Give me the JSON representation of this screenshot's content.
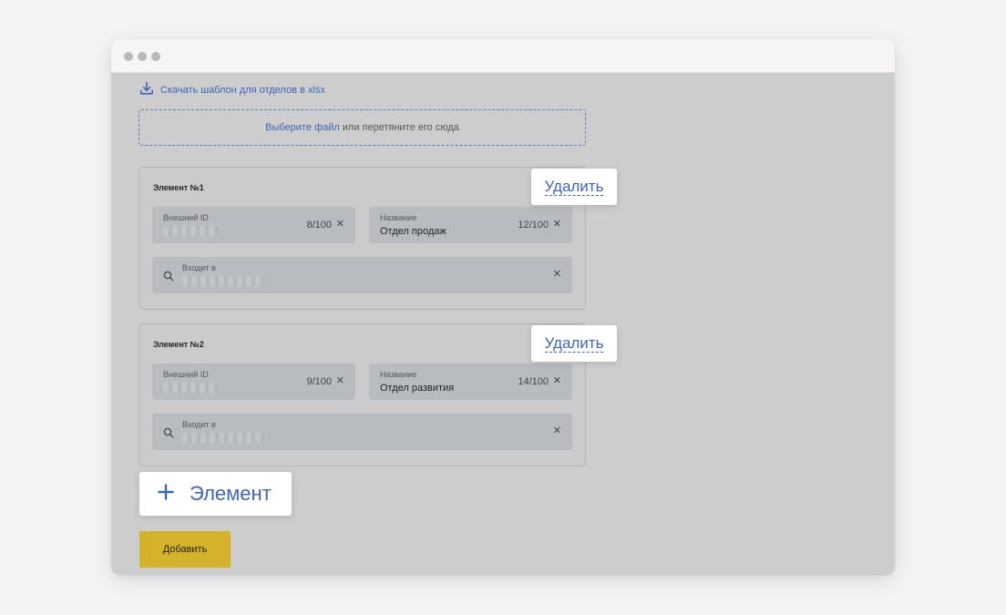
{
  "header": {
    "download_link": "Скачать шаблон для отделов в xlsx"
  },
  "dropzone": {
    "link": "Выберите файл",
    "text": "или перетяните его сюда"
  },
  "cards": [
    {
      "title": "Элемент №1",
      "delete_label": "Удалить",
      "external_id": {
        "label": "Внешний ID",
        "counter": "8/100"
      },
      "name": {
        "label": "Название",
        "value": "Отдел продаж",
        "counter": "12/100"
      },
      "parent": {
        "label": "Входит в"
      }
    },
    {
      "title": "Элемент №2",
      "delete_label": "Удалить",
      "external_id": {
        "label": "Внешний ID",
        "counter": "9/100"
      },
      "name": {
        "label": "Название",
        "value": "Отдел развития",
        "counter": "14/100"
      },
      "parent": {
        "label": "Входит в"
      }
    }
  ],
  "add_element": {
    "label": "Элемент"
  },
  "submit": {
    "label": "Добавить"
  },
  "icons": {
    "download": "download-icon",
    "search": "search-icon",
    "clear": "close-icon",
    "plus": "plus-icon"
  },
  "colors": {
    "accent": "#3f64b8",
    "submit_button": "#d4b32a"
  }
}
